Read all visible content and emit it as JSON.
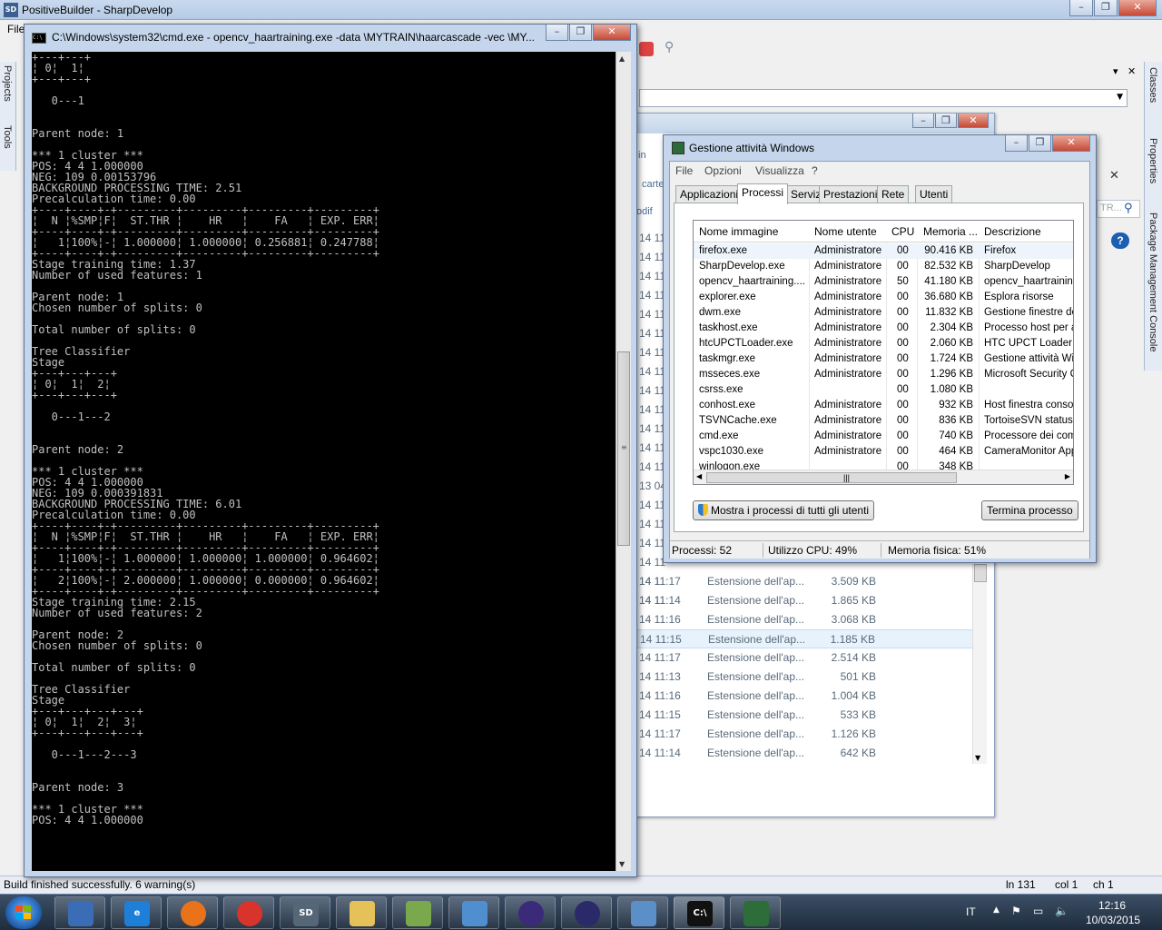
{
  "sharpdevelop": {
    "title": "PositiveBuilder - SharpDevelop",
    "menu_file": "File",
    "left_tabs": [
      "Projects",
      "Tools"
    ],
    "right_tabs": [
      "Classes",
      "Properties",
      "Package Management Console"
    ],
    "status_left": "Build finished successfully. 6 warning(s)",
    "status_line": "ln 131",
    "status_col": "col 1",
    "status_ch": "ch 1",
    "right_search_placeholder": "TR...",
    "help_label": "?"
  },
  "explorer": {
    "fragments": [
      "in",
      "carte",
      "odif"
    ],
    "rows": [
      {
        "date": "14 11:17",
        "type": "Estensione dell'ap...",
        "size": "3.509 KB"
      },
      {
        "date": "14 11:14",
        "type": "Estensione dell'ap...",
        "size": "1.865 KB"
      },
      {
        "date": "14 11:16",
        "type": "Estensione dell'ap...",
        "size": "3.068 KB"
      },
      {
        "date": "14 11:15",
        "type": "Estensione dell'ap...",
        "size": "1.185 KB"
      },
      {
        "date": "14 11:17",
        "type": "Estensione dell'ap...",
        "size": "2.514 KB"
      },
      {
        "date": "14 11:13",
        "type": "Estensione dell'ap...",
        "size": "501 KB"
      },
      {
        "date": "14 11:16",
        "type": "Estensione dell'ap...",
        "size": "1.004 KB"
      },
      {
        "date": "14 11:15",
        "type": "Estensione dell'ap...",
        "size": "533 KB"
      },
      {
        "date": "14 11:17",
        "type": "Estensione dell'ap...",
        "size": "1.126 KB"
      },
      {
        "date": "14 11:14",
        "type": "Estensione dell'ap...",
        "size": "642 KB"
      }
    ],
    "date_fragments": [
      "14 11",
      "14 11",
      "14 11",
      "14 11",
      "14 11",
      "14 11",
      "14 11",
      "14 11",
      "14 11",
      "14 11",
      "14 11",
      "14 11",
      "14 11",
      "13 04",
      "14 11",
      "14 11",
      "14 11",
      "14 11",
      "14 11",
      "14 11"
    ]
  },
  "cmd": {
    "title": "C:\\Windows\\system32\\cmd.exe - opencv_haartraining.exe  -data \\MYTRAIN\\haarcascade -vec \\MY...",
    "lines": [
      "+---+---+",
      "¦ 0¦  1¦",
      "+---+---+",
      "",
      "   0---1",
      "",
      "",
      "Parent node: 1",
      "",
      "*** 1 cluster ***",
      "POS: 4 4 1.000000",
      "NEG: 109 0.00153796",
      "BACKGROUND PROCESSING TIME: 2.51",
      "Precalculation time: 0.00",
      "+----+----+-+---------+---------+---------+---------+",
      "¦  N ¦%SMP¦F¦  ST.THR ¦    HR   ¦    FA   ¦ EXP. ERR¦",
      "+----+----+-+---------+---------+---------+---------+",
      "¦   1¦100%¦-¦ 1.000000¦ 1.000000¦ 0.256881¦ 0.247788¦",
      "+----+----+-+---------+---------+---------+---------+",
      "Stage training time: 1.37",
      "Number of used features: 1",
      "",
      "Parent node: 1",
      "Chosen number of splits: 0",
      "",
      "Total number of splits: 0",
      "",
      "Tree Classifier",
      "Stage",
      "+---+---+---+",
      "¦ 0¦  1¦  2¦",
      "+---+---+---+",
      "",
      "   0---1---2",
      "",
      "",
      "Parent node: 2",
      "",
      "*** 1 cluster ***",
      "POS: 4 4 1.000000",
      "NEG: 109 0.000391831",
      "BACKGROUND PROCESSING TIME: 6.01",
      "Precalculation time: 0.00",
      "+----+----+-+---------+---------+---------+---------+",
      "¦  N ¦%SMP¦F¦  ST.THR ¦    HR   ¦    FA   ¦ EXP. ERR¦",
      "+----+----+-+---------+---------+---------+---------+",
      "¦   1¦100%¦-¦ 1.000000¦ 1.000000¦ 1.000000¦ 0.964602¦",
      "+----+----+-+---------+---------+---------+---------+",
      "¦   2¦100%¦-¦ 2.000000¦ 1.000000¦ 0.000000¦ 0.964602¦",
      "+----+----+-+---------+---------+---------+---------+",
      "Stage training time: 2.15",
      "Number of used features: 2",
      "",
      "Parent node: 2",
      "Chosen number of splits: 0",
      "",
      "Total number of splits: 0",
      "",
      "Tree Classifier",
      "Stage",
      "+---+---+---+---+",
      "¦ 0¦  1¦  2¦  3¦",
      "+---+---+---+---+",
      "",
      "   0---1---2---3",
      "",
      "",
      "Parent node: 3",
      "",
      "*** 1 cluster ***",
      "POS: 4 4 1.000000"
    ]
  },
  "taskmgr": {
    "title": "Gestione attività Windows",
    "menu": [
      "File",
      "Opzioni",
      "Visualizza",
      "?"
    ],
    "tabs": [
      "Applicazioni",
      "Processi",
      "Servizi",
      "Prestazioni",
      "Rete",
      "Utenti"
    ],
    "active_tab": "Processi",
    "columns": [
      "Nome immagine",
      "Nome utente",
      "CPU",
      "Memoria ...",
      "Descrizione"
    ],
    "processes": [
      {
        "name": "firefox.exe",
        "user": "Administratore",
        "cpu": "00",
        "mem": "90.416 KB",
        "desc": "Firefox"
      },
      {
        "name": "SharpDevelop.exe",
        "user": "Administratore",
        "cpu": "00",
        "mem": "82.532 KB",
        "desc": "SharpDevelop"
      },
      {
        "name": "opencv_haartraining....",
        "user": "Administratore",
        "cpu": "50",
        "mem": "41.180 KB",
        "desc": "opencv_haartraining"
      },
      {
        "name": "explorer.exe",
        "user": "Administratore",
        "cpu": "00",
        "mem": "36.680 KB",
        "desc": "Esplora risorse"
      },
      {
        "name": "dwm.exe",
        "user": "Administratore",
        "cpu": "00",
        "mem": "11.832 KB",
        "desc": "Gestione finestre de"
      },
      {
        "name": "taskhost.exe",
        "user": "Administratore",
        "cpu": "00",
        "mem": "2.304 KB",
        "desc": "Processo host per a"
      },
      {
        "name": "htcUPCTLoader.exe",
        "user": "Administratore",
        "cpu": "00",
        "mem": "2.060 KB",
        "desc": "HTC UPCT Loader"
      },
      {
        "name": "taskmgr.exe",
        "user": "Administratore",
        "cpu": "00",
        "mem": "1.724 KB",
        "desc": "Gestione attività Wi"
      },
      {
        "name": "msseces.exe",
        "user": "Administratore",
        "cpu": "00",
        "mem": "1.296 KB",
        "desc": "Microsoft Security C"
      },
      {
        "name": "csrss.exe",
        "user": "",
        "cpu": "00",
        "mem": "1.080 KB",
        "desc": ""
      },
      {
        "name": "conhost.exe",
        "user": "Administratore",
        "cpu": "00",
        "mem": "932 KB",
        "desc": "Host finestra consol"
      },
      {
        "name": "TSVNCache.exe",
        "user": "Administratore",
        "cpu": "00",
        "mem": "836 KB",
        "desc": "TortoiseSVN status"
      },
      {
        "name": "cmd.exe",
        "user": "Administratore",
        "cpu": "00",
        "mem": "740 KB",
        "desc": "Processore dei coma"
      },
      {
        "name": "vspc1030.exe",
        "user": "Administratore",
        "cpu": "00",
        "mem": "464 KB",
        "desc": "CameraMonitor App"
      },
      {
        "name": "winlogon.exe",
        "user": "",
        "cpu": "00",
        "mem": "348 KB",
        "desc": ""
      }
    ],
    "show_all_button": "Mostra i processi di tutti gli utenti",
    "end_process_button": "Termina processo",
    "status_processes": "Processi: 52",
    "status_cpu": "Utilizzo CPU: 49%",
    "status_memory": "Memoria fisica: 51%"
  },
  "taskbar": {
    "items": [
      {
        "name": "network-app",
        "label": "",
        "color": "#3a6db5"
      },
      {
        "name": "internet-explorer",
        "label": "e",
        "color": "#1e7fd8"
      },
      {
        "name": "firefox",
        "label": "",
        "color": "#e8731b"
      },
      {
        "name": "chrome",
        "label": "",
        "color": "#d8342c"
      },
      {
        "name": "sharpdevelop",
        "label": "SD",
        "color": "#556677"
      },
      {
        "name": "file-explorer",
        "label": "",
        "color": "#e5c15a"
      },
      {
        "name": "notepad-app",
        "label": "",
        "color": "#7aa84c"
      },
      {
        "name": "network-tool",
        "label": "",
        "color": "#4f8fcf"
      },
      {
        "name": "eclipse-1",
        "label": "",
        "color": "#3b2a7a"
      },
      {
        "name": "eclipse-2",
        "label": "",
        "color": "#2a2a6a"
      },
      {
        "name": "control-panel",
        "label": "",
        "color": "#5b8fc7"
      },
      {
        "name": "cmd",
        "label": "C:\\",
        "color": "#111111"
      },
      {
        "name": "task-manager",
        "label": "",
        "color": "#2d6d3a"
      }
    ],
    "lang": "IT",
    "time": "12:16",
    "date": "10/03/2015"
  }
}
